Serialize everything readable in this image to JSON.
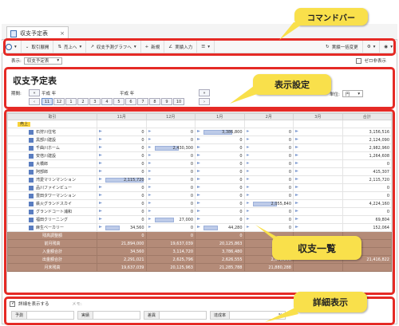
{
  "window": {
    "tab_title": "収支予定表",
    "tab_close": "×"
  },
  "toolbar": {
    "account_expand": "取引展開",
    "sales_direction": "売上へ",
    "graph_label": "収支予測グラフへ",
    "new_label": "新規",
    "actual_input": "実績入力",
    "bulk_change": "実績一括変更"
  },
  "display": {
    "label": "表示:",
    "select_value": "収支予定表",
    "nonzero_label": "ゼロ非表示"
  },
  "title": "収支予定表",
  "period": {
    "label": "期間:",
    "year_left": "平成  年",
    "year_right": "平成  年",
    "months": [
      "11",
      "12",
      "1",
      "2",
      "3",
      "4",
      "5",
      "6",
      "7",
      "8",
      "9",
      "10"
    ],
    "selected_month": "11",
    "unit_label": "単位:",
    "unit_value": "円"
  },
  "grid": {
    "headers": [
      "取引",
      "11月",
      "12月",
      "1月",
      "2月",
      "3月",
      "合計"
    ],
    "group_label": "売上",
    "rows": [
      {
        "name": "石狩川住宅",
        "values": [
          "0",
          "0",
          "3,386,800",
          "0",
          "",
          "3,156,516"
        ],
        "bar": [
          0,
          0,
          0.6,
          0,
          0
        ]
      },
      {
        "name": "黒部川建設",
        "values": [
          "0",
          "0",
          "0",
          "0",
          "",
          "2,124,090"
        ],
        "bar": [
          0,
          0,
          0,
          0,
          0
        ]
      },
      {
        "name": "千曲川ホーム",
        "values": [
          "0",
          "2,430,300",
          "0",
          "0",
          "",
          "2,982,960"
        ],
        "bar": [
          0,
          0.5,
          0,
          0,
          0
        ]
      },
      {
        "name": "安倍川建設",
        "values": [
          "0",
          "0",
          "0",
          "0",
          "",
          "1,264,608"
        ],
        "bar": [
          0,
          0,
          0,
          0,
          0
        ]
      },
      {
        "name": "大橋郎",
        "values": [
          "0",
          "0",
          "0",
          "0",
          "",
          "0"
        ],
        "bar": [
          0,
          0,
          0,
          0,
          0
        ]
      },
      {
        "name": "阿部郎",
        "values": [
          "0",
          "0",
          "0",
          "0",
          "",
          "415,307"
        ],
        "bar": [
          0,
          0,
          0,
          0,
          0
        ]
      },
      {
        "name": "湾愛マリンマンション",
        "values": [
          "2,115,720",
          "0",
          "0",
          "0",
          "",
          "2,115,720"
        ],
        "bar": [
          0.8,
          0,
          0,
          0,
          0
        ]
      },
      {
        "name": "品川ファインビュー",
        "values": [
          "0",
          "0",
          "0",
          "0",
          "",
          "0"
        ],
        "bar": [
          0,
          0,
          0,
          0,
          0
        ]
      },
      {
        "name": "豊田タワーマンション",
        "values": [
          "0",
          "0",
          "0",
          "0",
          "",
          "0"
        ],
        "bar": [
          0,
          0,
          0,
          0,
          0
        ]
      },
      {
        "name": "鉄火グランドスカイ",
        "values": [
          "0",
          "0",
          "0",
          "2,055,840",
          "",
          "4,224,160"
        ],
        "bar": [
          0,
          0,
          0,
          0.5,
          0
        ]
      },
      {
        "name": "グランドコート浦和",
        "values": [
          "0",
          "0",
          "0",
          "0",
          "",
          "0"
        ],
        "bar": [
          0,
          0,
          0,
          0,
          0
        ]
      },
      {
        "name": "福田クリーニング",
        "values": [
          "0",
          "27,000",
          "0",
          "0",
          "",
          "69,804"
        ],
        "bar": [
          0,
          0.4,
          0,
          0,
          0
        ]
      },
      {
        "name": "麻生ベーカリー",
        "values": [
          "34,560",
          "0",
          "44,280",
          "0",
          "",
          "152,064"
        ],
        "bar": [
          0.3,
          0,
          0.3,
          0,
          0
        ]
      }
    ],
    "summary": [
      {
        "name": "残高調整額",
        "values": [
          "0",
          "0",
          "0",
          "",
          "",
          ""
        ]
      },
      {
        "name": "前月残高",
        "values": [
          "21,894,000",
          "19,637,039",
          "20,125,863",
          "",
          "",
          ""
        ]
      },
      {
        "name": "入金額合計",
        "values": [
          "34,560",
          "3,114,720",
          "3,786,480",
          "",
          "",
          ""
        ]
      },
      {
        "name": "出金額合計",
        "values": [
          "2,291,021",
          "2,625,796",
          "2,626,555",
          "2,672,298",
          "",
          "21,416,822"
        ]
      },
      {
        "name": "月末残高",
        "values": [
          "19,637,039",
          "20,125,963",
          "21,285,788",
          "21,880,288",
          "",
          ""
        ]
      }
    ]
  },
  "detail": {
    "checkbox_label": "詳細を表示する",
    "memo_label": "メモ:",
    "fields": [
      "予測",
      "実績",
      "差異",
      "達成率"
    ],
    "percent": "%"
  },
  "callouts": {
    "command_bar": "コマンドバー",
    "display_settings": "表示設定",
    "balance_list": "収支一覧",
    "detail_display": "詳細表示"
  },
  "colors": {
    "callout": "#f9e04b",
    "highlight_border": "#e52a25",
    "summary_row": "#b48b78",
    "bar_fill": "#bdcbe8"
  }
}
